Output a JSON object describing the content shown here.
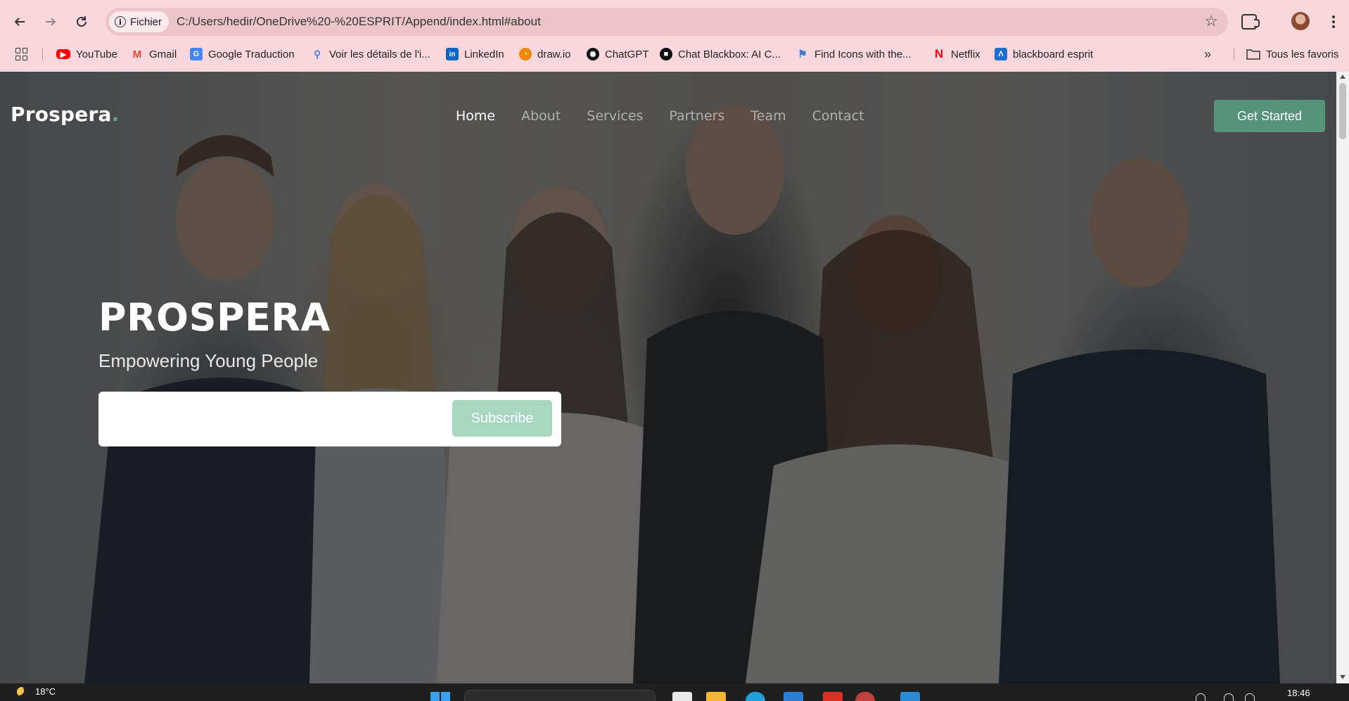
{
  "browser": {
    "chip_label": "Fichier",
    "url": "C:/Users/hedir/OneDrive%20-%20ESPRIT/Append/index.html#about",
    "icons": {
      "back": "arrow-left-icon",
      "forward": "arrow-right-icon",
      "reload": "reload-icon",
      "info": "info-icon",
      "star": "star-icon",
      "extensions": "puzzle-icon",
      "profile": "avatar",
      "menu": "kebab-menu-icon"
    },
    "bookmarks": [
      {
        "label": "YouTube",
        "icon": "youtube-icon",
        "color": "#ff0000"
      },
      {
        "label": "Gmail",
        "icon": "gmail-icon",
        "color": "#ea4335"
      },
      {
        "label": "Google Traduction",
        "icon": "google-translate-icon",
        "color": "#4285f4"
      },
      {
        "label": "Voir les détails de l'i...",
        "icon": "search-icon",
        "color": "#4285f4"
      },
      {
        "label": "LinkedIn",
        "icon": "linkedin-icon",
        "color": "#0a66c2"
      },
      {
        "label": "draw.io",
        "icon": "drawio-icon",
        "color": "#f08705"
      },
      {
        "label": "ChatGPT",
        "icon": "chatgpt-icon",
        "color": "#111111"
      },
      {
        "label": "Chat Blackbox: AI C...",
        "icon": "blackbox-icon",
        "color": "#111111"
      },
      {
        "label": "Find Icons with the...",
        "icon": "flag-icon",
        "color": "#3a7bd5"
      },
      {
        "label": "Netflix",
        "icon": "netflix-icon",
        "color": "#e50914"
      },
      {
        "label": "blackboard esprit",
        "icon": "blackboard-icon",
        "color": "#1f6fd1"
      }
    ],
    "all_bookmarks_label": "Tous les favoris"
  },
  "site": {
    "logo": "Prospera",
    "logo_dot": ".",
    "nav": [
      {
        "label": "Home",
        "active": true
      },
      {
        "label": "About",
        "active": false
      },
      {
        "label": "Services",
        "active": false
      },
      {
        "label": "Partners",
        "active": false
      },
      {
        "label": "Team",
        "active": false
      },
      {
        "label": "Contact",
        "active": false
      }
    ],
    "cta_label": "Get Started",
    "hero": {
      "title": "PROSPERA",
      "subtitle": "Empowering Young People",
      "input_placeholder": "",
      "subscribe_label": "Subscribe"
    },
    "colors": {
      "accent": "#55947a",
      "subscribe": "#a7d6c1"
    }
  },
  "taskbar": {
    "temperature": "18°C",
    "time": "18:46"
  }
}
